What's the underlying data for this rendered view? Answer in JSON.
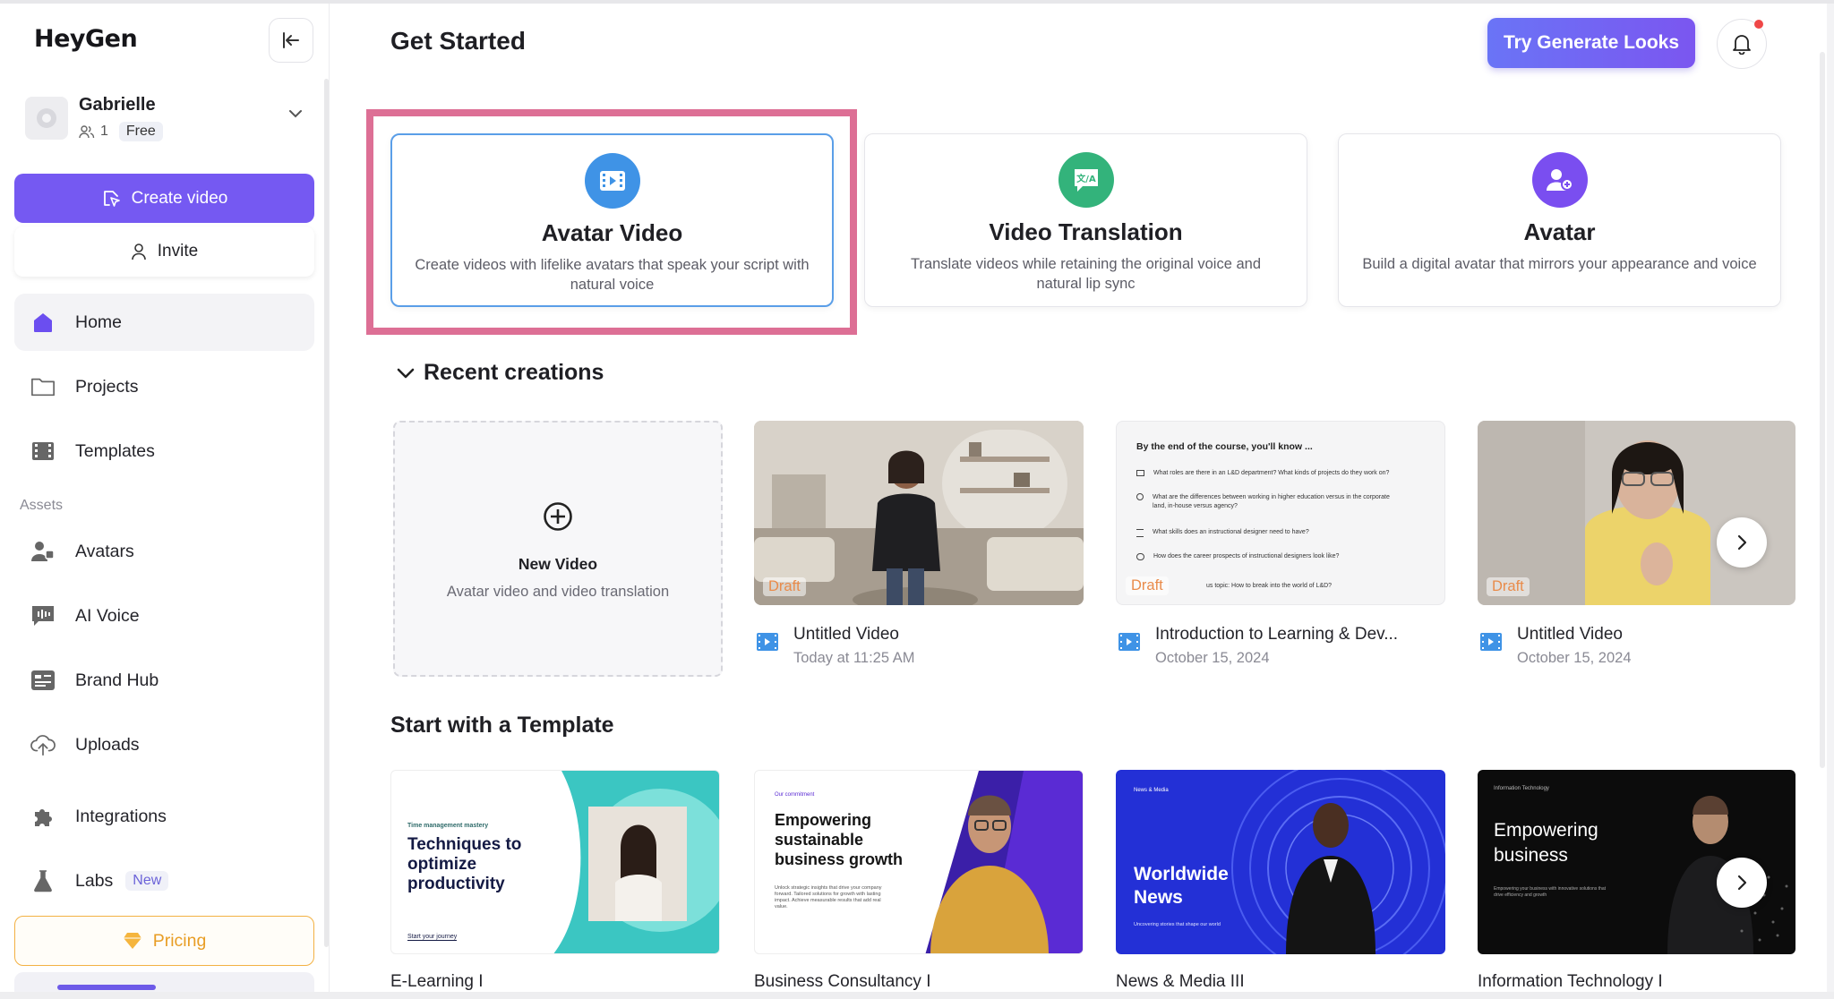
{
  "app": {
    "logo": "HeyGen"
  },
  "user": {
    "name": "Gabrielle",
    "members": "1",
    "plan": "Free"
  },
  "sidebar": {
    "create_label": "Create video",
    "invite_label": "Invite",
    "nav": [
      {
        "label": "Home",
        "icon": "home-icon"
      },
      {
        "label": "Projects",
        "icon": "folder-icon"
      },
      {
        "label": "Templates",
        "icon": "film-icon"
      }
    ],
    "assets_label": "Assets",
    "assets": [
      {
        "label": "Avatars",
        "icon": "avatar-icon"
      },
      {
        "label": "AI Voice",
        "icon": "voice-icon"
      },
      {
        "label": "Brand Hub",
        "icon": "brand-icon"
      },
      {
        "label": "Uploads",
        "icon": "cloud-upload-icon"
      },
      {
        "label": "Integrations",
        "icon": "puzzle-icon"
      },
      {
        "label": "Labs",
        "icon": "flask-icon",
        "badge": "New"
      }
    ],
    "pricing_label": "Pricing"
  },
  "header": {
    "title": "Get Started",
    "try_label": "Try Generate Looks"
  },
  "features": [
    {
      "title": "Avatar Video",
      "desc": "Create videos with lifelike avatars that speak your script with natural voice",
      "icon": "video-icon",
      "color": "#3f93e6"
    },
    {
      "title": "Video Translation",
      "desc": "Translate videos while retaining the original voice and natural lip sync",
      "icon": "translate-icon",
      "color": "#33b37b"
    },
    {
      "title": "Avatar",
      "desc": "Build a digital avatar that mirrors your appearance and voice",
      "icon": "user-add-icon",
      "color": "#7a4ef0"
    }
  ],
  "recent": {
    "heading": "Recent creations",
    "new_video": {
      "title": "New Video",
      "subtitle": "Avatar video and video translation"
    },
    "items": [
      {
        "title": "Untitled Video",
        "date": "Today at 11:25 AM",
        "badge": "Draft"
      },
      {
        "title": "Introduction to Learning & Dev...",
        "date": "October 15, 2024",
        "badge": "Draft"
      },
      {
        "title": "Untitled Video",
        "date": "October 15, 2024",
        "badge": "Draft"
      }
    ],
    "slide": {
      "heading": "By the end of the course, you'll know ...",
      "lines": [
        "What roles are there in an L&D department? What kinds of projects do they work on?",
        "What are the differences between working in higher education versus in the corporate land, in-house versus agency?",
        "What skills does an instructional designer need to have?",
        "How does the career prospects of instructional designers look like?",
        "us topic: How to break into the world of L&D?"
      ]
    }
  },
  "templates": {
    "heading": "Start with a Template",
    "items": [
      {
        "name": "E-Learning I",
        "kicker": "Time management mastery",
        "headline": "Techniques to optimize productivity",
        "footer": "Start your journey"
      },
      {
        "name": "Business Consultancy I",
        "kicker": "Our commitment",
        "headline": "Empowering sustainable business growth",
        "body": "Unlock strategic insights that drive your company forward. Tailored solutions for growth with lasting impact. Achieve measurable results that add real value."
      },
      {
        "name": "News & Media III",
        "kicker": "News & Media",
        "headline": "Worldwide News",
        "footer": "Uncovering stories that shape our world"
      },
      {
        "name": "Information Technology I",
        "kicker": "Information Technology",
        "headline": "Empowering business",
        "footer": "Empowering your business with innovative solutions that drive efficiency and growth"
      }
    ]
  }
}
